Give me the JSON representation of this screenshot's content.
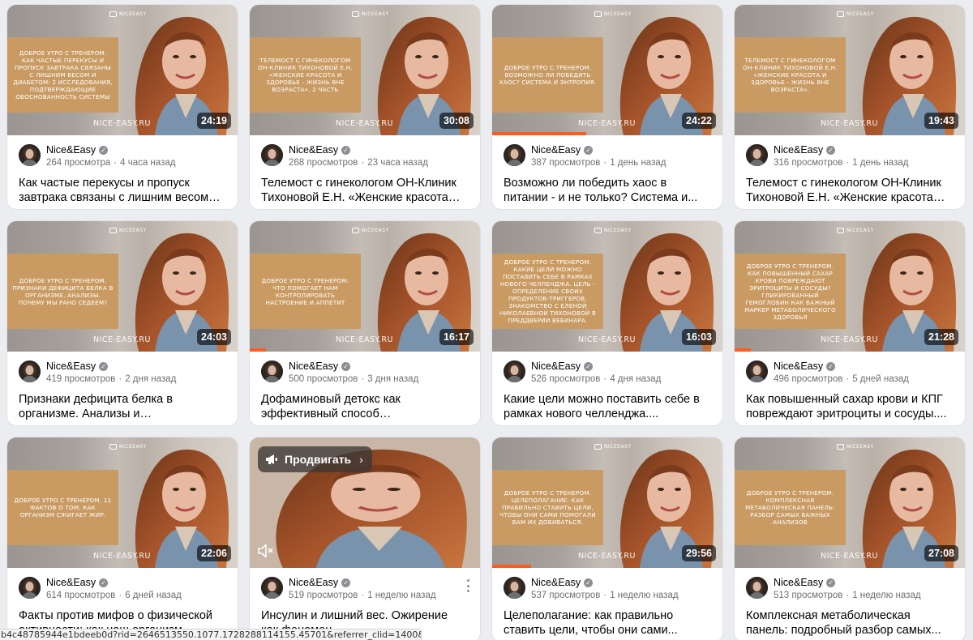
{
  "channel": {
    "name": "Nice&Easy",
    "site": "NICE-EASY.RU",
    "logo_text": "NICEEASY"
  },
  "promo": {
    "label": "Продвигать"
  },
  "status_url": "b4c48785944e1bdeeb0d?rid=2646513550.1077.1728288114155.45701&referrer_clid=1400&",
  "colors": {
    "progress": "#ff5a1f",
    "overlay": "#c99b63",
    "background": "#ebedf0"
  },
  "videos": [
    {
      "overlay": "Доброе утро с тренером. Как частые перекусы и пропуск завтрака связаны с лишним весом и диабетом: 2 исследования, подтверждающие обоснованность системы",
      "duration": "24:19",
      "progress": 0,
      "views": "264 просмотра",
      "age": "4 часа назад",
      "title": "Как частые перекусы и пропуск завтрака связаны с лишним весом и..."
    },
    {
      "overlay": "Телемост с гинекологом Он-Клиник Тихоновой Е.Н. «Женские красота и здоровье - жизнь вне возраста». 2 часть",
      "duration": "30:08",
      "progress": 0,
      "views": "268 просмотров",
      "age": "23 часа назад",
      "title": "Телемост с гинекологом ОН-Клиник Тихоновой Е.Н. «Женские красота и..."
    },
    {
      "overlay": "Доброе утро с тренером. Возможно ли победить хаос? Система и энтропия.",
      "duration": "24:22",
      "progress": 0.41,
      "views": "387 просмотров",
      "age": "1 день назад",
      "title": "Возможно ли победить хаос в питании - и не только? Система и..."
    },
    {
      "overlay": "Телемост с гинекологом Он-Клиник Тихоновой Е.Н. «Женские красота и здоровье - жизнь вне возраста».",
      "duration": "19:43",
      "progress": 0,
      "views": "316 просмотров",
      "age": "1 день назад",
      "title": "Телемост с гинекологом ОН-Клиник Тихоновой Е.Н. «Женские красота и..."
    },
    {
      "overlay": "Доброе утро с тренером. Признаки дефицита белка в организме. Анализы. Почему мы рано седеем?",
      "duration": "24:03",
      "progress": 0,
      "views": "419 просмотров",
      "age": "2 дня назад",
      "title": "Признаки дефицита белка в организме. Анализы и субъективны..."
    },
    {
      "overlay": "Доброе утро с тренером: что помогает нам контролировать настроение и аппетит",
      "duration": "16:17",
      "progress": 0.07,
      "views": "500 просмотров",
      "age": "3 дня назад",
      "title": "Дофаминовый детокс как эффективный способ оздоровления..."
    },
    {
      "overlay": "Доброе утро с тренером. Какие цели можно поставить себе в рамках нового челленджа. Цель - определение своих продуктов-триггеров. Знакомство с Еленой Николаевной Тихоновой в преддверии вебинара.",
      "duration": "16:03",
      "progress": 0,
      "views": "526 просмотров",
      "age": "4 дня назад",
      "title": "Какие цели можно поставить себе в рамках нового челленджа...."
    },
    {
      "overlay": "Доброе утро с тренером. Как повышенный сахар крови повреждают эритроциты и сосуды? Гликированный гемоглобин как важный маркер метаболического здоровья",
      "duration": "21:28",
      "progress": 0.07,
      "views": "496 просмотров",
      "age": "5 дней назад",
      "title": "Как повышенный сахар крови и КПГ повреждают эритроциты и сосуды...."
    },
    {
      "overlay": "Доброе утро с тренером. 11 фактов о том, как организм сжигает жир.",
      "duration": "22:06",
      "progress": 0,
      "views": "614 просмотров",
      "age": "6 дней назад",
      "title": "Факты против мифов о физической активности: как наш организм..."
    },
    {
      "overlay": "",
      "duration": "",
      "progress": 0,
      "views": "519 просмотров",
      "age": "1 неделю назад",
      "title": "Инсулин и лишний вес. Ожирение как феномен инсулинорезистентности ..."
    },
    {
      "overlay": "Доброе утро с тренером. Целеполагание: как правильно ставить цели, чтобы они сами помогали вам их добиваться.",
      "duration": "29:56",
      "progress": 0.17,
      "views": "537 просмотров",
      "age": "1 неделю назад",
      "title": "Целеполагание: как правильно ставить цели, чтобы они сами..."
    },
    {
      "overlay": "Доброе утро с тренером. Комплексная метаболическая панель: разбор самых важных анализов",
      "duration": "27:08",
      "progress": 0,
      "views": "513 просмотров",
      "age": "1 неделю назад",
      "title": "Комплексная метаболическая панель: подробный разбор самых..."
    }
  ]
}
